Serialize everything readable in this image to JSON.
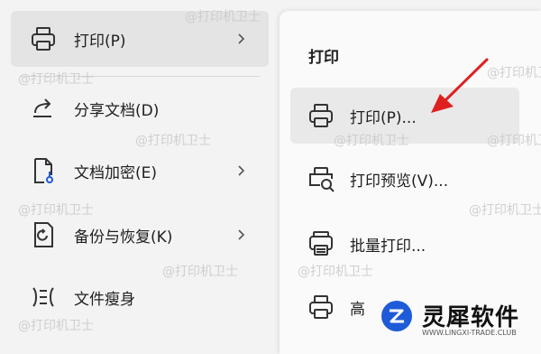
{
  "left_menu": {
    "items": [
      {
        "label": "打印(P)",
        "icon": "printer-icon",
        "submenu": true,
        "active": true
      },
      {
        "label": "分享文档(D)",
        "icon": "share-icon",
        "submenu": false
      },
      {
        "label": "文档加密(E)",
        "icon": "document-lock-icon",
        "submenu": true
      },
      {
        "label": "备份与恢复(K)",
        "icon": "backup-restore-icon",
        "submenu": true
      },
      {
        "label": "文件瘦身",
        "icon": "compress-icon",
        "submenu": false
      }
    ]
  },
  "submenu": {
    "title": "打印",
    "items": [
      {
        "label": "打印(P)...",
        "icon": "printer-icon",
        "hover": true
      },
      {
        "label": "打印预览(V)...",
        "icon": "print-preview-icon"
      },
      {
        "label": "批量打印...",
        "icon": "batch-print-icon"
      },
      {
        "label": "高",
        "icon": "printer-icon"
      }
    ]
  },
  "watermark_text": "@打印机卫士",
  "brand": {
    "name": "灵犀软件",
    "url": "WWW.LINGXI-TRADE.CLUB",
    "icon": "lingxi-logo-icon"
  },
  "colors": {
    "arrow": "#e02020",
    "active_bg": "#e4e4e4",
    "hover_bg": "#e9e9e9",
    "brand_blue": "#1e5bd8"
  }
}
